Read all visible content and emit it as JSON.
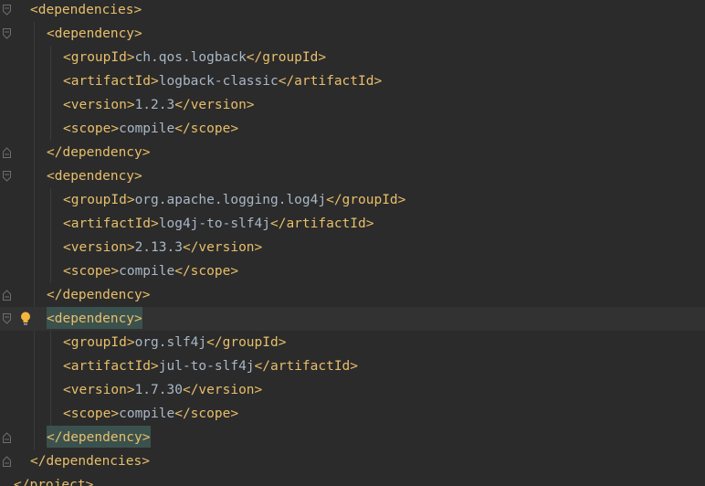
{
  "editor": {
    "colors": {
      "background": "#2b2b2b",
      "tag": "#e8bf6a",
      "text": "#a9b7c6",
      "current_line": "#323232",
      "match_highlight": "#3b514d"
    },
    "lines": [
      {
        "indent": 1,
        "parts": [
          {
            "t": "tag",
            "v": "<dependencies>"
          }
        ],
        "fold": "open"
      },
      {
        "indent": 2,
        "parts": [
          {
            "t": "tag",
            "v": "<dependency>"
          }
        ],
        "fold": "open"
      },
      {
        "indent": 3,
        "parts": [
          {
            "t": "tag",
            "v": "<groupId>"
          },
          {
            "t": "txt",
            "v": "ch.qos.logback"
          },
          {
            "t": "tag",
            "v": "</groupId>"
          }
        ]
      },
      {
        "indent": 3,
        "parts": [
          {
            "t": "tag",
            "v": "<artifactId>"
          },
          {
            "t": "txt",
            "v": "logback-classic"
          },
          {
            "t": "tag",
            "v": "</artifactId>"
          }
        ]
      },
      {
        "indent": 3,
        "parts": [
          {
            "t": "tag",
            "v": "<version>"
          },
          {
            "t": "txt",
            "v": "1.2.3"
          },
          {
            "t": "tag",
            "v": "</version>"
          }
        ]
      },
      {
        "indent": 3,
        "parts": [
          {
            "t": "tag",
            "v": "<scope>"
          },
          {
            "t": "txt",
            "v": "compile"
          },
          {
            "t": "tag",
            "v": "</scope>"
          }
        ]
      },
      {
        "indent": 2,
        "parts": [
          {
            "t": "tag",
            "v": "</dependency>"
          }
        ],
        "fold": "close"
      },
      {
        "indent": 2,
        "parts": [
          {
            "t": "tag",
            "v": "<dependency>"
          }
        ],
        "fold": "open"
      },
      {
        "indent": 3,
        "parts": [
          {
            "t": "tag",
            "v": "<groupId>"
          },
          {
            "t": "txt",
            "v": "org.apache.logging.log4j"
          },
          {
            "t": "tag",
            "v": "</groupId>"
          }
        ]
      },
      {
        "indent": 3,
        "parts": [
          {
            "t": "tag",
            "v": "<artifactId>"
          },
          {
            "t": "txt",
            "v": "log4j-to-slf4j"
          },
          {
            "t": "tag",
            "v": "</artifactId>"
          }
        ]
      },
      {
        "indent": 3,
        "parts": [
          {
            "t": "tag",
            "v": "<version>"
          },
          {
            "t": "txt",
            "v": "2.13.3"
          },
          {
            "t": "tag",
            "v": "</version>"
          }
        ]
      },
      {
        "indent": 3,
        "parts": [
          {
            "t": "tag",
            "v": "<scope>"
          },
          {
            "t": "txt",
            "v": "compile"
          },
          {
            "t": "tag",
            "v": "</scope>"
          }
        ]
      },
      {
        "indent": 2,
        "parts": [
          {
            "t": "tag",
            "v": "</dependency>"
          }
        ],
        "fold": "close"
      },
      {
        "indent": 2,
        "parts": [
          {
            "t": "tag",
            "v": "<dependency>",
            "hl": true
          }
        ],
        "fold": "open",
        "current": true,
        "bulb": true
      },
      {
        "indent": 3,
        "parts": [
          {
            "t": "tag",
            "v": "<groupId>"
          },
          {
            "t": "txt",
            "v": "org.slf4j"
          },
          {
            "t": "tag",
            "v": "</groupId>"
          }
        ]
      },
      {
        "indent": 3,
        "parts": [
          {
            "t": "tag",
            "v": "<artifactId>"
          },
          {
            "t": "txt",
            "v": "jul-to-slf4j"
          },
          {
            "t": "tag",
            "v": "</artifactId>"
          }
        ]
      },
      {
        "indent": 3,
        "parts": [
          {
            "t": "tag",
            "v": "<version>"
          },
          {
            "t": "txt",
            "v": "1.7.30"
          },
          {
            "t": "tag",
            "v": "</version>"
          }
        ]
      },
      {
        "indent": 3,
        "parts": [
          {
            "t": "tag",
            "v": "<scope>"
          },
          {
            "t": "txt",
            "v": "compile"
          },
          {
            "t": "tag",
            "v": "</scope>"
          }
        ]
      },
      {
        "indent": 2,
        "parts": [
          {
            "t": "tag",
            "v": "</dependency>",
            "hl": true
          }
        ],
        "fold": "close"
      },
      {
        "indent": 1,
        "parts": [
          {
            "t": "tag",
            "v": "</dependencies>"
          }
        ],
        "fold": "close"
      },
      {
        "indent": 0,
        "parts": [
          {
            "t": "tag",
            "v": "</project>"
          }
        ]
      }
    ]
  },
  "icons": {
    "fold_marker": "fold-marker-icon",
    "intention": "lightbulb-icon"
  }
}
